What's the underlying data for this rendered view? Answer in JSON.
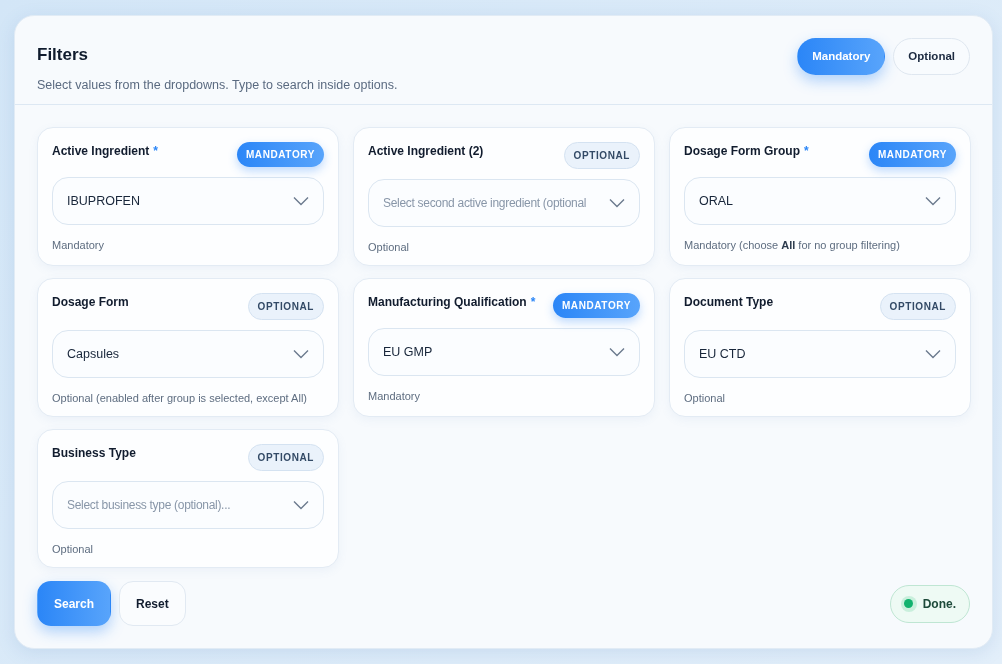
{
  "header": {
    "title": "Filters",
    "subtitle": "Select values from the dropdowns. Type to search inside options."
  },
  "toggle": [
    {
      "label": "Mandatory",
      "selected": true
    },
    {
      "label": "Optional",
      "selected": false
    }
  ],
  "fields": [
    {
      "label": "Active Ingredient",
      "required_mark": "*",
      "badge": {
        "kind": "mandatory",
        "text": "MANDATORY"
      },
      "value": "IBUPROFEN",
      "help": "Mandatory"
    },
    {
      "label": "Active Ingredient (2)",
      "badge": {
        "kind": "optional",
        "text": "OPTIONAL"
      },
      "placeholder": "Select second active ingredient (optional",
      "help": "Optional"
    },
    {
      "label": "Dosage Form Group",
      "required_mark": "*",
      "badge": {
        "kind": "mandatory",
        "text": "MANDATORY"
      },
      "value": "ORAL",
      "help": "Mandatory (choose **All** for no group filtering)"
    },
    {
      "label": "Dosage Form",
      "badge": {
        "kind": "optional",
        "text": "OPTIONAL"
      },
      "value": "Capsules",
      "help": "Optional (enabled after group is selected, except All)"
    },
    {
      "label": "Manufacturing Qualification",
      "required_mark": "*",
      "badge": {
        "kind": "mandatory",
        "text": "MANDATORY"
      },
      "value": "EU GMP",
      "help": "Mandatory"
    },
    {
      "label": "Document Type",
      "badge": {
        "kind": "optional",
        "text": "OPTIONAL"
      },
      "value": "EU CTD",
      "help": "Optional"
    },
    {
      "label": "Business Type",
      "badge": {
        "kind": "optional",
        "text": "OPTIONAL"
      },
      "placeholder": "Select business type (optional)...",
      "help": "Optional"
    }
  ],
  "actions": [
    {
      "label": "Search",
      "kind": "primary"
    },
    {
      "label": "Reset",
      "kind": "secondary"
    }
  ],
  "status": {
    "text": "Done."
  }
}
